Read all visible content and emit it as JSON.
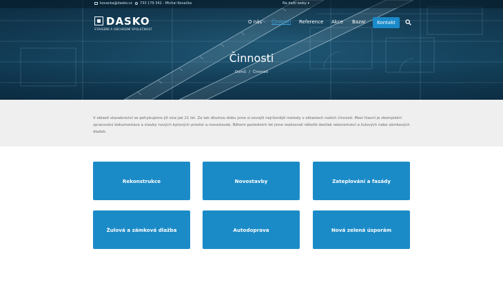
{
  "topbar": {
    "email": "kovacka@dasko.cz",
    "phone_contact": "733 179 342 - Michal Kovačka",
    "more_links": "Na další weby"
  },
  "brand": {
    "name": "DASKO",
    "tagline": "STAVEBNÍ A OBCHODNÍ SPOLEČNOST"
  },
  "nav": {
    "items": [
      {
        "label": "O nás",
        "active": false
      },
      {
        "label": "Činnosti",
        "active": true
      },
      {
        "label": "Reference",
        "active": false
      },
      {
        "label": "Akce",
        "active": false
      },
      {
        "label": "Bazar",
        "active": false
      }
    ],
    "contact_label": "Kontakt",
    "search_icon": "search-icon"
  },
  "page": {
    "title": "Činnosti",
    "breadcrumb": [
      "Domů",
      "Činnosti"
    ],
    "breadcrumb_separator": "/"
  },
  "intro": {
    "text": "V oblasti stavebnictví se pohybujeme již více jak 21 let. Za tak dlouhou dobu jsme si osvojili nejrůznější metody v oblastech našich činností. Mezi hlavní je zkompletní zpracování dokumentace a stavby nových bytových prostor a novostaveb. Během posledních let jsme realizovali několik desítek rekonstrukcí a žulových nebo zámkových dlažeb."
  },
  "services": [
    "Rekonstrukce",
    "Novostavby",
    "Zateplování a fasády",
    "Žulová a zámková dlažba",
    "Autodoprava",
    "Nová zelená úsporám"
  ],
  "colors": {
    "accent": "#1b8bc8",
    "active_nav": "#3aa4e0",
    "intro_bg": "#efefef"
  }
}
